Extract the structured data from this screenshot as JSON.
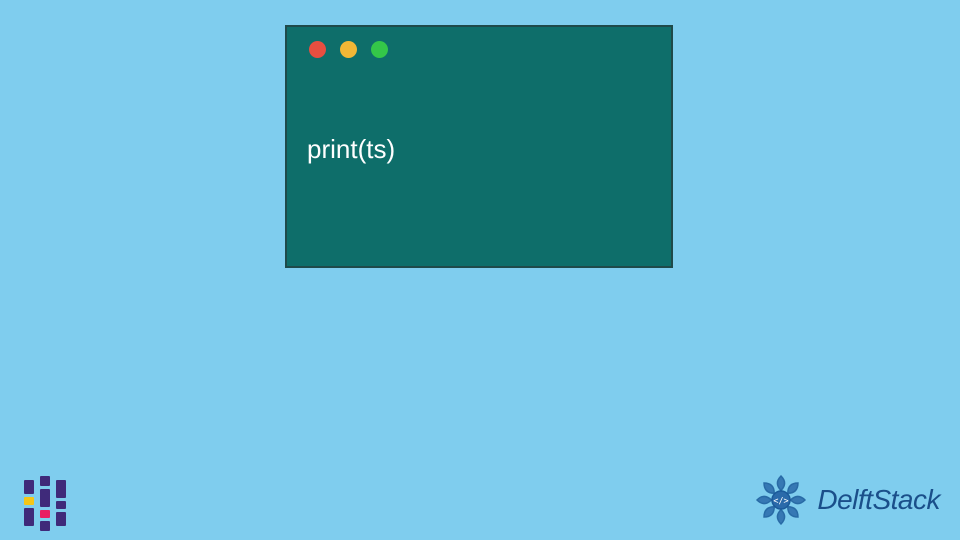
{
  "code_window": {
    "content": "print(ts)",
    "traffic_lights": {
      "red": "#e84e40",
      "yellow": "#f2b736",
      "green": "#34c749"
    }
  },
  "brand": {
    "name": "DelftStack",
    "color": "#1a4f8a"
  },
  "background_color": "#7fcdee",
  "window_color": "#0e6e6a"
}
